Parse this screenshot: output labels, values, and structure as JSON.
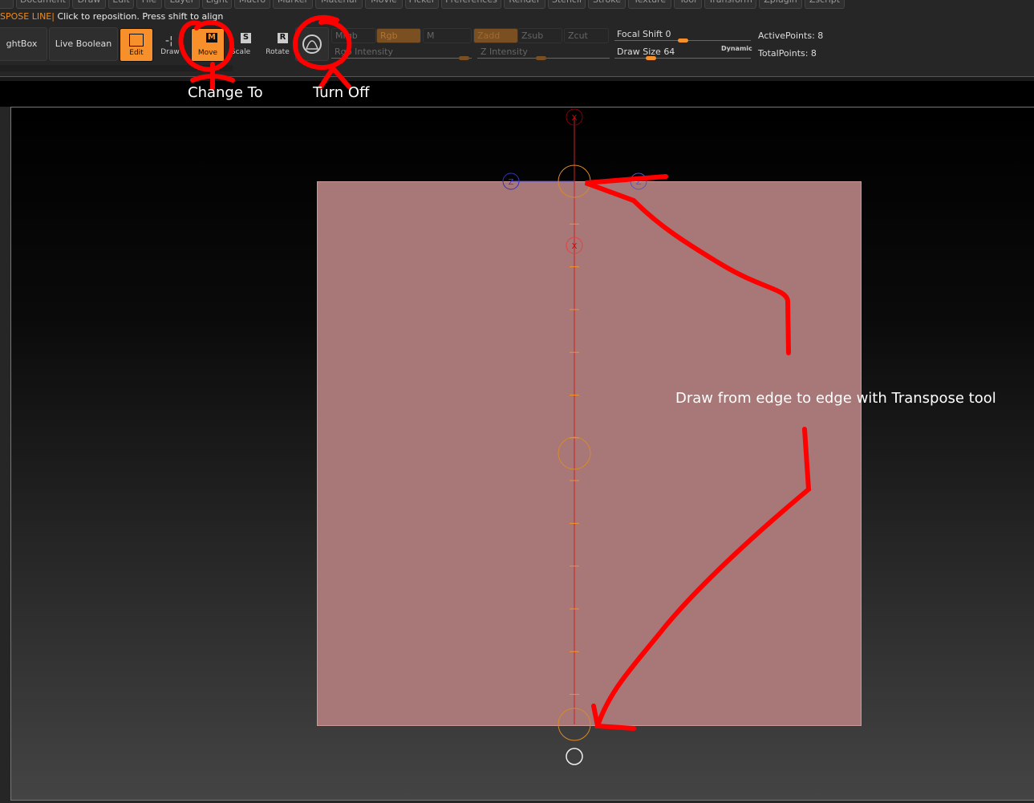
{
  "menu": [
    "ol",
    "Document",
    "Draw",
    "Edit",
    "File",
    "Layer",
    "Light",
    "Macro",
    "Marker",
    "Material",
    "Movie",
    "Picker",
    "Preferences",
    "Render",
    "Stencil",
    "Stroke",
    "Texture",
    "Tool",
    "Transform",
    "Zplugin",
    "Zscript"
  ],
  "status": {
    "mode": "SPOSE LINE|",
    "hint": "Click to reposition. Press shift to align"
  },
  "toolbar": {
    "lightbox": "ghtBox",
    "live_boolean": "Live Boolean",
    "edit": "Edit",
    "draw": "Draw",
    "move": "Move",
    "scale": "Scale",
    "rotate": "Rotate",
    "mrgb": "Mrgb",
    "rgb": "Rgb",
    "m": "M",
    "rgb_intensity": "Rgb Intensity",
    "zadd": "Zadd",
    "zsub": "Zsub",
    "zcut": "Zcut",
    "z_intensity": "Z Intensity",
    "focal_shift": "Focal Shift",
    "focal_shift_value": "0",
    "draw_size": "Draw Size",
    "draw_size_value": "64",
    "dynamic": "Dynamic",
    "active_points": "ActivePoints: 8",
    "total_points": "TotalPoints: 8"
  },
  "colors": {
    "accent": "#f7902a",
    "mesh": "#a87777",
    "annotation": "#ff0000"
  },
  "annotations": {
    "change_to": "Change To",
    "turn_off": "Turn Off",
    "instruction": "Draw from edge to edge with Transpose tool"
  },
  "gizmo": {
    "x_label": "X",
    "z_label": "Z"
  }
}
